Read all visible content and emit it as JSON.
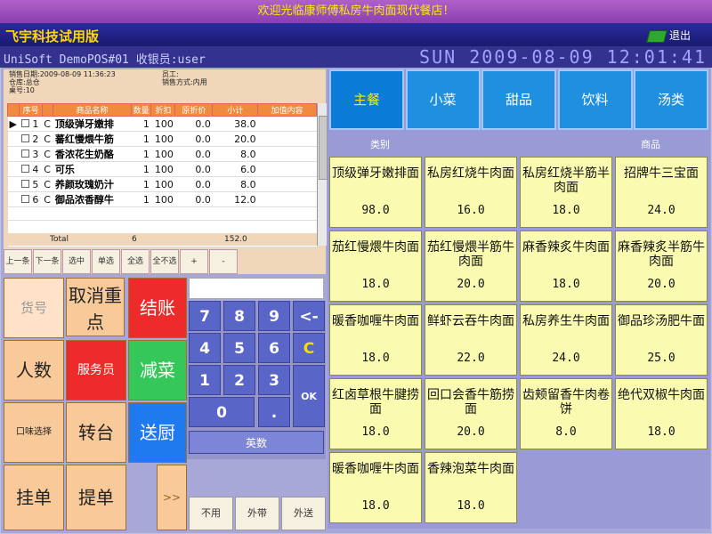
{
  "banner": "欢迎光临康师傅私房牛肉面现代餐店！",
  "title": "飞宇科技试用版",
  "exit_label": "退出",
  "status": {
    "left": "UniSoft DemoPOS#01 收银员:user",
    "right": "SUN 2009-08-09 12:01:41"
  },
  "order_info": {
    "line1": "销售日期:2009-08-09 11:36:23",
    "line2": "仓库:总仓",
    "line3": "桌号:10",
    "line4": "员工:",
    "line5": "销售方式:内用"
  },
  "grid": {
    "headers": [
      "",
      "序号",
      "",
      "商品名称",
      "数量",
      "折扣",
      "原折价",
      "小计",
      "加值内容"
    ],
    "rows": [
      [
        "1",
        "C",
        "顶级弹牙嫩排",
        "1",
        "100",
        "0.0",
        "38.0"
      ],
      [
        "2",
        "C",
        "蕃红慢煨牛筋",
        "1",
        "100",
        "0.0",
        "20.0"
      ],
      [
        "3",
        "C",
        "香浓花生奶酪",
        "1",
        "100",
        "0.0",
        "8.0"
      ],
      [
        "4",
        "C",
        "可乐",
        "1",
        "100",
        "0.0",
        "6.0"
      ],
      [
        "5",
        "C",
        "养颜玫瑰奶汁",
        "1",
        "100",
        "0.0",
        "8.0"
      ],
      [
        "6",
        "C",
        "御品浓香醇牛",
        "1",
        "100",
        "0.0",
        "12.0"
      ]
    ],
    "total_label": "Total",
    "total_qty": "6",
    "total_amount": "152.0"
  },
  "nav": [
    "上一条",
    "下一条",
    "选中",
    "单选",
    "全选",
    "全不选",
    "+",
    "-"
  ],
  "keys_left": {
    "huohao": "货号",
    "quxiao": "取消重点",
    "jiezhang": "结账",
    "renshu": "人数",
    "fuwuyuan": "服务员",
    "jiancai": "减菜",
    "kouwei": "口味选择",
    "zhuantai": "转台",
    "songchu": "送厨",
    "guadan": "挂单",
    "tidan": "提单",
    "more": ">>"
  },
  "numpad": {
    "keys": [
      "7",
      "8",
      "9",
      "<-",
      "4",
      "5",
      "6",
      "C",
      "1",
      "2",
      "3",
      "OK",
      "0",
      "."
    ],
    "yingshu": "英数",
    "bottom": [
      "不用",
      "外带",
      "外送"
    ]
  },
  "categories": [
    "主餐",
    "小菜",
    "甜品",
    "饮料",
    "汤类"
  ],
  "menu_heads": {
    "left": "类别",
    "right": "商品"
  },
  "items": [
    {
      "name": "顶级弹牙嫩排面",
      "price": "98.0"
    },
    {
      "name": "私房红烧牛肉面",
      "price": "16.0"
    },
    {
      "name": "私房红烧半筋半肉面",
      "price": "18.0"
    },
    {
      "name": "招牌牛三宝面",
      "price": "24.0"
    },
    {
      "name": "茄红慢煨牛肉面",
      "price": "18.0"
    },
    {
      "name": "茄红慢煨半筋牛肉面",
      "price": "20.0"
    },
    {
      "name": "麻香辣炙牛肉面",
      "price": "18.0"
    },
    {
      "name": "麻香辣炙半筋牛肉面",
      "price": "20.0"
    },
    {
      "name": "暖香咖喱牛肉面",
      "price": "18.0"
    },
    {
      "name": "鲜虾云吞牛肉面",
      "price": "22.0"
    },
    {
      "name": "私房养生牛肉面",
      "price": "24.0"
    },
    {
      "name": "御品珍汤肥牛面",
      "price": "25.0"
    },
    {
      "name": "红卤草根牛腱捞面",
      "price": "18.0"
    },
    {
      "name": "回口会香牛筋捞面",
      "price": "20.0"
    },
    {
      "name": "齿颊留香牛肉卷饼",
      "price": "8.0"
    },
    {
      "name": "绝代双椒牛肉面",
      "price": "18.0"
    },
    {
      "name": "暖香咖喱牛肉面",
      "price": "18.0"
    },
    {
      "name": "香辣泡菜牛肉面",
      "price": "18.0"
    }
  ],
  "colors": {
    "banner_text": "#f4f000",
    "menu_item": "#fafbb0",
    "accent_red": "#ee2b2b",
    "accent_green": "#35c75a",
    "accent_blue": "#1f7af0"
  }
}
